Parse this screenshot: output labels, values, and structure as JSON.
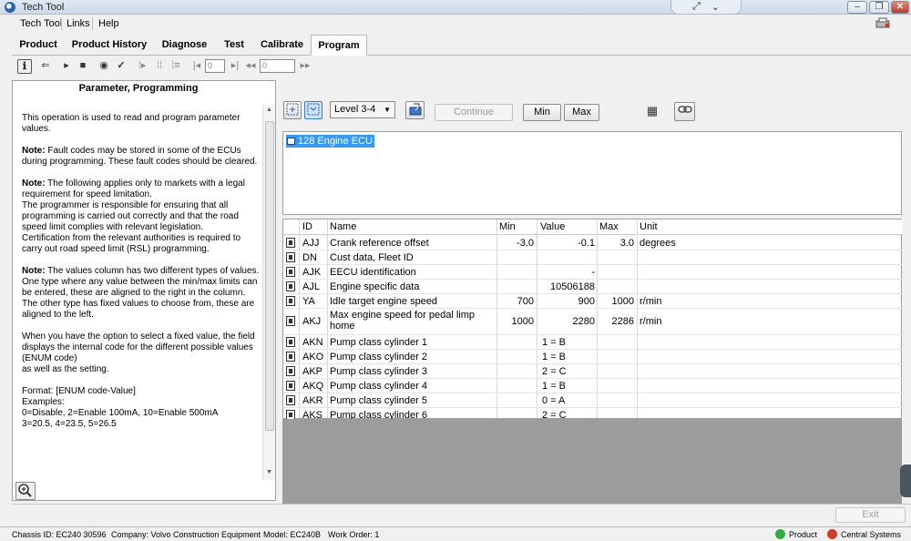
{
  "window": {
    "title": "Tech Tool"
  },
  "menu": {
    "items": [
      "Tech Tool",
      "Links",
      "Help"
    ]
  },
  "tabs": [
    "Product",
    "Product History",
    "Diagnose",
    "Test",
    "Calibrate",
    "Program"
  ],
  "active_tab": "Program",
  "toolbar": {
    "page_input": "0",
    "step_input": "0"
  },
  "help_panel": {
    "title": "Parameter, Programming",
    "paragraphs": [
      {
        "strong": "",
        "text": "This operation is used to read and program parameter values."
      },
      {
        "strong": "Note:",
        "text": " Fault codes may be stored in some of the ECUs during programming. These fault codes should be cleared."
      },
      {
        "strong": "Note:",
        "text": " The following applies only to markets with a legal requirement for speed limitation.\nThe programmer is responsible for ensuring that all programming is carried out correctly and that the road speed limit complies with relevant legislation.\nCertification from the relevant authorities is required to carry out road speed limit (RSL) programming."
      },
      {
        "strong": "Note:",
        "text": " The values column has two different types of values.\nOne type where any value between the min/max limits can be entered, these are aligned to the right in the column.\nThe other type has fixed values to choose from, these are\naligned to the left."
      },
      {
        "strong": "",
        "text": "When you have the option to select a fixed value, the field\ndisplays the internal code for the different possible values (ENUM code)\nas well as the setting."
      },
      {
        "strong": "",
        "text": "Format: [ENUM code-Value]\nExamples:\n0=Disable, 2=Enable 100mA, 10=Enable 500mA\n3=20.5, 4=23.5, 5=26.5"
      }
    ]
  },
  "program_panel": {
    "level_select": "Level 3-4",
    "continue_label": "Continue",
    "min_label": "Min",
    "max_label": "Max",
    "ecu": "128  Engine ECU",
    "columns": [
      "ID",
      "Name",
      "Min",
      "Value",
      "Max",
      "Unit"
    ],
    "rows": [
      {
        "id": "AJJ",
        "name": "Crank reference offset",
        "min": "-3.0",
        "value": "-0.1",
        "max": "3.0",
        "unit": "degrees",
        "align": "right"
      },
      {
        "id": "DN",
        "name": "Cust data, Fleet ID",
        "min": "",
        "value": "",
        "max": "",
        "unit": "",
        "align": "right"
      },
      {
        "id": "AJK",
        "name": "EECU identification",
        "min": "",
        "value": "-",
        "max": "",
        "unit": "",
        "align": "right"
      },
      {
        "id": "AJL",
        "name": "Engine specific data",
        "min": "",
        "value": "10506188",
        "max": "",
        "unit": "",
        "align": "right"
      },
      {
        "id": "YA",
        "name": "Idle target engine speed",
        "min": "700",
        "value": "900",
        "max": "1000",
        "unit": "r/min",
        "align": "right"
      },
      {
        "id": "AKJ",
        "name": "Max engine speed for pedal limp home",
        "min": "1000",
        "value": "2280",
        "max": "2286",
        "unit": "r/min",
        "align": "right"
      },
      {
        "id": "AKN",
        "name": "Pump class cylinder 1",
        "min": "",
        "value": "1 = B",
        "max": "",
        "unit": "",
        "align": "left"
      },
      {
        "id": "AKO",
        "name": "Pump class cylinder 2",
        "min": "",
        "value": "1 = B",
        "max": "",
        "unit": "",
        "align": "left"
      },
      {
        "id": "AKP",
        "name": "Pump class cylinder 3",
        "min": "",
        "value": "2 = C",
        "max": "",
        "unit": "",
        "align": "left"
      },
      {
        "id": "AKQ",
        "name": "Pump class cylinder 4",
        "min": "",
        "value": "1 = B",
        "max": "",
        "unit": "",
        "align": "left"
      },
      {
        "id": "AKR",
        "name": "Pump class cylinder 5",
        "min": "",
        "value": "0 = A",
        "max": "",
        "unit": "",
        "align": "left"
      },
      {
        "id": "AKS",
        "name": "Pump class cylinder 6",
        "min": "",
        "value": "2 = C",
        "max": "",
        "unit": "",
        "align": "left"
      }
    ],
    "exit_label": "Exit"
  },
  "status": {
    "chassis": "Chassis ID: EC240 30596",
    "company": "Company: Volvo Construction Equipment",
    "model": "Model: EC240B",
    "work_order": "Work Order: 1",
    "product_label": "Product",
    "central_label": "Central Systems",
    "product_color": "#2fae3a",
    "central_color": "#d63a2a"
  }
}
